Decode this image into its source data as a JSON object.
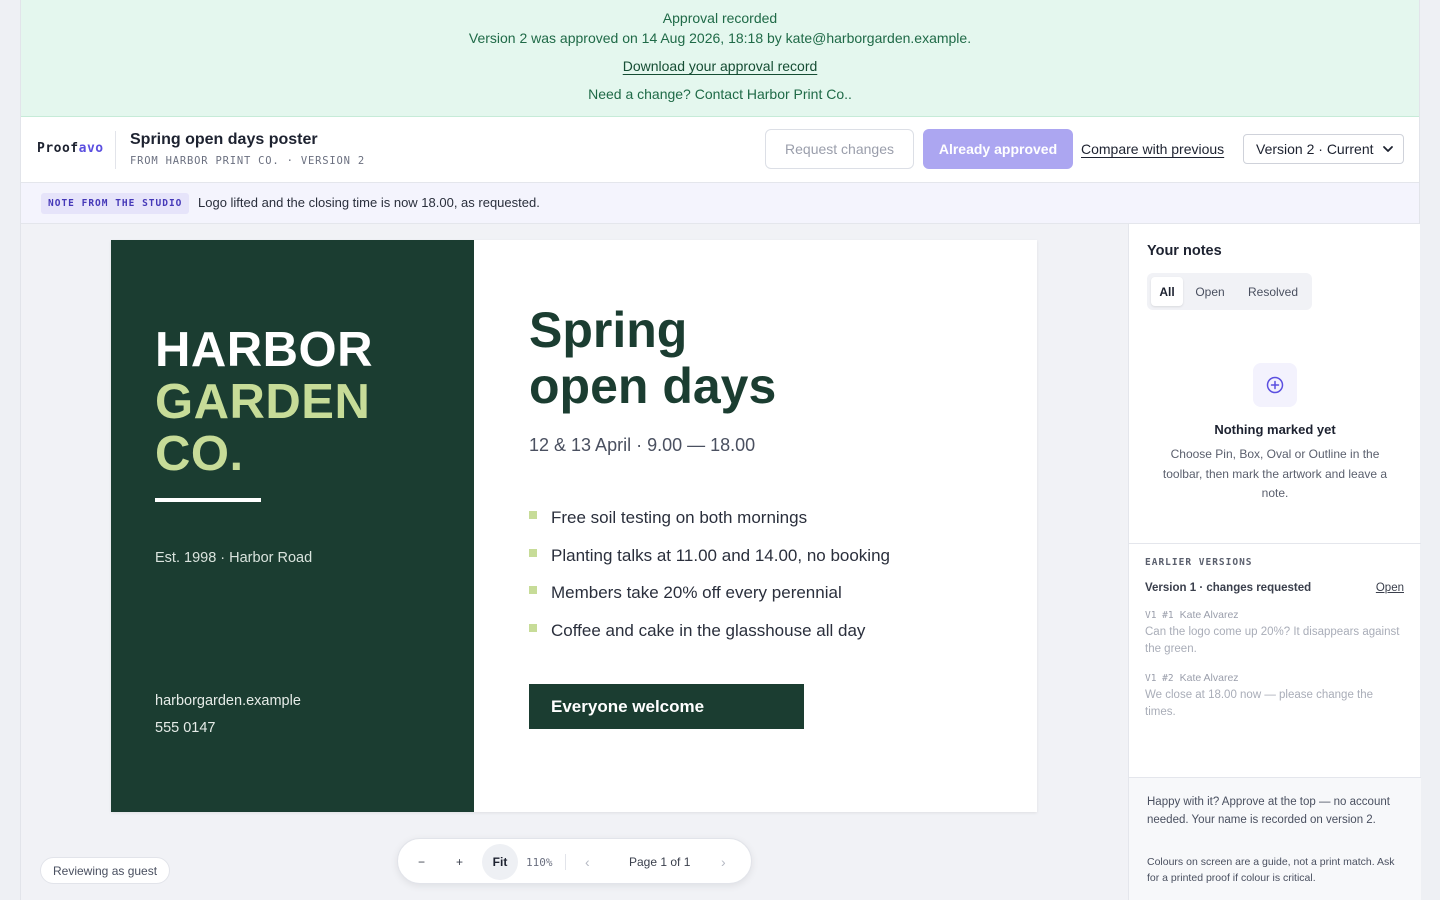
{
  "banner": {
    "title": "Approval recorded",
    "line": "Version 2 was approved on 14 Aug 2026, 18:18 by kate@harborgarden.example.",
    "download_link": "Download your approval record",
    "need_change": "Need a change? Contact Harbor Print Co.."
  },
  "header": {
    "logo_main": "Proof",
    "logo_accent": "avo",
    "doc_title": "Spring open days poster",
    "doc_subtitle": "FROM HARBOR PRINT CO. · VERSION 2",
    "request_changes_label": "Request changes",
    "approved_label": "Already approved",
    "compare_label": "Compare with previous",
    "version_selected": "Version 2 · Current"
  },
  "studio_note": {
    "tag": "NOTE FROM THE STUDIO",
    "text": "Logo lifted and the closing time is now 18.00, as requested."
  },
  "poster": {
    "name_line1": "HARBOR",
    "name_line2": "GARDEN",
    "name_line3": "CO.",
    "est": "Est. 1998 · Harbor Road",
    "website": "harborgarden.example",
    "phone": "555 0147",
    "title_line1": "Spring",
    "title_line2": "open days",
    "date_line": "12 & 13 April  ·  9.00 — 18.00",
    "bullets": [
      "Free soil testing on both mornings",
      "Planting talks at 11.00 and 14.00, no booking",
      "Members take 20% off every perennial",
      "Coffee and cake in the glasshouse all day"
    ],
    "cta": "Everyone welcome",
    "colors": {
      "dark_green": "#1b3d31",
      "light_green": "#c7dc98"
    }
  },
  "guest_label": "Reviewing as guest",
  "toolbar": {
    "zoom_out": "−",
    "zoom_in": "+",
    "fit": "Fit",
    "zoom_level": "110%",
    "prev": "‹",
    "page": "Page 1 of 1",
    "next": "›"
  },
  "sidebar": {
    "title": "Your notes",
    "filters": [
      "All",
      "Open",
      "Resolved"
    ],
    "active_filter": "All",
    "empty_icon": "plus-circle-icon",
    "empty_title": "Nothing marked yet",
    "empty_desc": "Choose Pin, Box, Oval or Outline in the toolbar, then mark the artwork and leave a note.",
    "earlier_heading": "EARLIER VERSIONS",
    "v1_label": "Version 1 · changes requested",
    "v1_open": "Open",
    "comments": [
      {
        "ref": "V1 #1",
        "author": "Kate Alvarez",
        "text": "Can the logo come up 20%? It disappears against the green."
      },
      {
        "ref": "V1 #2",
        "author": "Kate Alvarez",
        "text": "We close at 18.00 now — please change the times."
      }
    ],
    "footer_note": "Happy with it? Approve at the top — no account needed. Your name is recorded on version 2.",
    "footer_disclaimer": "Colours on screen are a guide, not a print match. Ask for a printed proof if colour is critical."
  }
}
